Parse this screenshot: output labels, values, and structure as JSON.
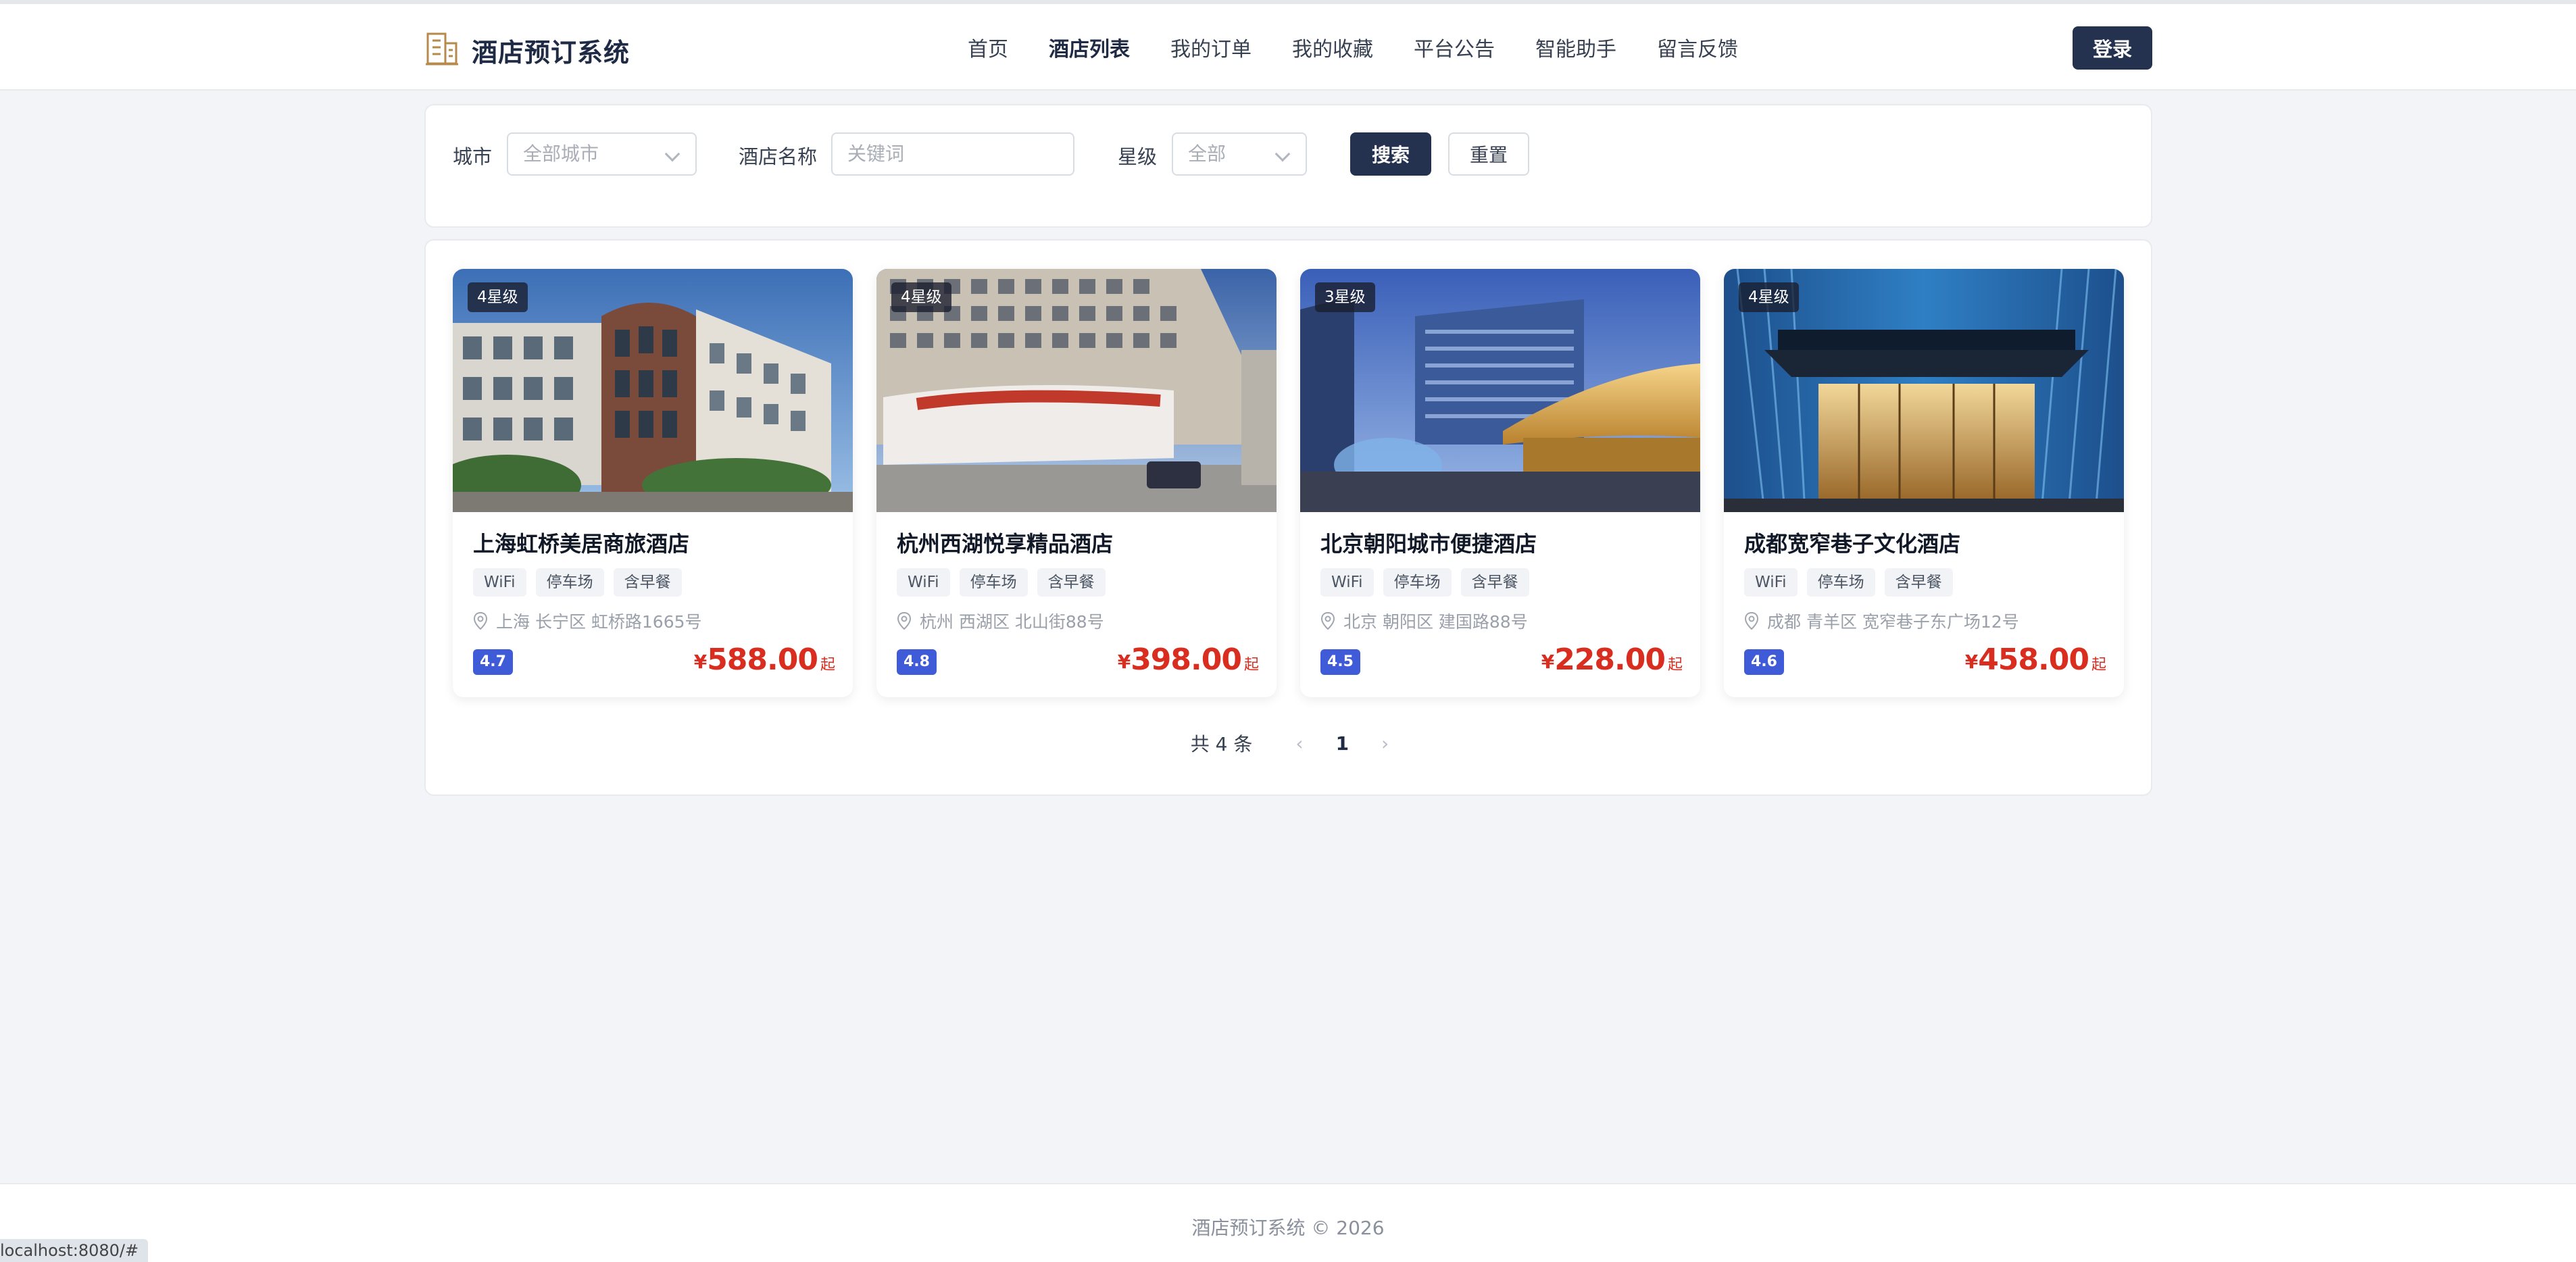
{
  "header": {
    "logo_text": "酒店预订系统",
    "nav": [
      {
        "label": "首页",
        "active": false
      },
      {
        "label": "酒店列表",
        "active": true
      },
      {
        "label": "我的订单",
        "active": false
      },
      {
        "label": "我的收藏",
        "active": false
      },
      {
        "label": "平台公告",
        "active": false
      },
      {
        "label": "智能助手",
        "active": false
      },
      {
        "label": "留言反馈",
        "active": false
      }
    ],
    "login_label": "登录"
  },
  "filters": {
    "city_label": "城市",
    "city_placeholder": "全部城市",
    "name_label": "酒店名称",
    "name_placeholder": "关键词",
    "star_label": "星级",
    "star_placeholder": "全部",
    "search_label": "搜索",
    "reset_label": "重置"
  },
  "hotels": [
    {
      "star": "4星级",
      "name": "上海虹桥美居商旅酒店",
      "tags": [
        "WiFi",
        "停车场",
        "含早餐"
      ],
      "address": "上海 长宁区 虹桥路1665号",
      "rating": "4.7",
      "currency": "¥",
      "price": "588.00",
      "price_suffix": "起"
    },
    {
      "star": "4星级",
      "name": "杭州西湖悦享精品酒店",
      "tags": [
        "WiFi",
        "停车场",
        "含早餐"
      ],
      "address": "杭州 西湖区 北山街88号",
      "rating": "4.8",
      "currency": "¥",
      "price": "398.00",
      "price_suffix": "起"
    },
    {
      "star": "3星级",
      "name": "北京朝阳城市便捷酒店",
      "tags": [
        "WiFi",
        "停车场",
        "含早餐"
      ],
      "address": "北京 朝阳区 建国路88号",
      "rating": "4.5",
      "currency": "¥",
      "price": "228.00",
      "price_suffix": "起"
    },
    {
      "star": "4星级",
      "name": "成都宽窄巷子文化酒店",
      "tags": [
        "WiFi",
        "停车场",
        "含早餐"
      ],
      "address": "成都 青羊区 宽窄巷子东广场12号",
      "rating": "4.6",
      "currency": "¥",
      "price": "458.00",
      "price_suffix": "起"
    }
  ],
  "pagination": {
    "total_text": "共 4 条",
    "prev": "‹",
    "current": "1",
    "next": "›"
  },
  "footer": {
    "text": "酒店预订系统 © 2026"
  },
  "status_bar": {
    "url": "localhost:8080/#"
  },
  "colors": {
    "primary": "#24324f",
    "price": "#d92d20",
    "rating": "#3f5bd8",
    "logo_icon": "#b58a4a"
  }
}
